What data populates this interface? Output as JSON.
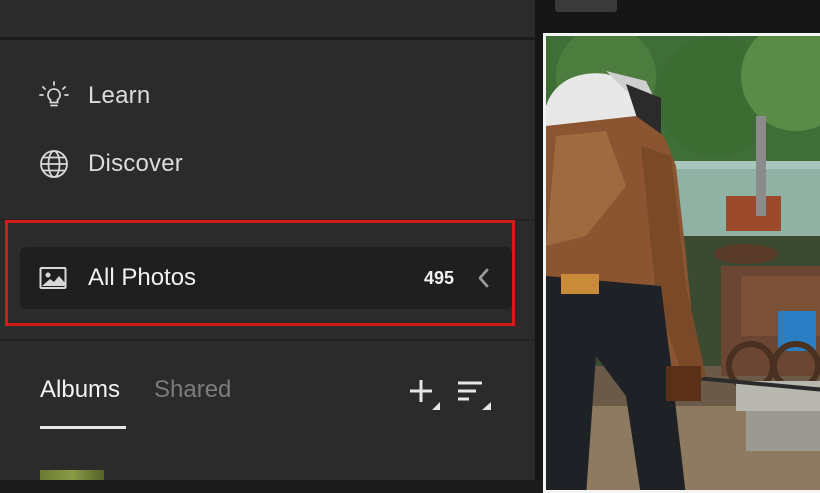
{
  "nav": {
    "learn_label": "Learn",
    "discover_label": "Discover",
    "learn_icon": "lightbulb-icon",
    "discover_icon": "globe-icon"
  },
  "library": {
    "all_photos_label": "All Photos",
    "all_photos_count": "495",
    "all_photos_icon": "image-icon",
    "collapse_icon": "chevron-left-icon",
    "highlight_color": "#d51a1a"
  },
  "tabs": [
    {
      "label": "Albums",
      "active": true
    },
    {
      "label": "Shared",
      "active": false
    }
  ],
  "toolbar": {
    "add_icon": "plus-icon",
    "sort_icon": "sort-icon"
  },
  "colors": {
    "sidebar_bg": "#2b2b2b",
    "selected_row_bg": "#1f1f1f",
    "accent_border": "#d51a1a"
  },
  "photo": {
    "subject": "welder"
  }
}
